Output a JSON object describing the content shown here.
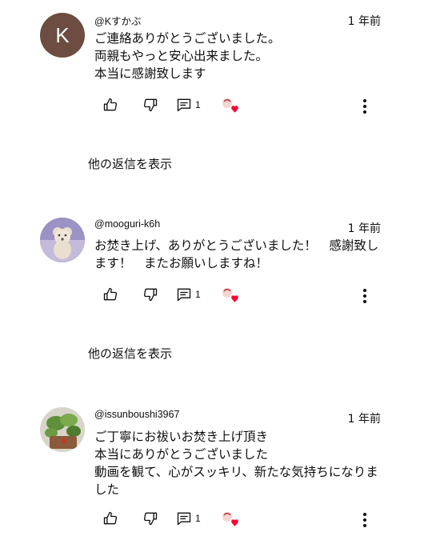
{
  "comments": [
    {
      "avatar_letter": "K",
      "avatar_color": "#6d4c41",
      "handle": "@Kすかぶ",
      "time": "1 年前",
      "text": "ご連絡ありがとうございました。\n両親もやっと安心出来ました。\n本当に感謝致します",
      "reply_count": "1",
      "show_replies": "他の返信を表示"
    },
    {
      "avatar_image": "teddy-bear-photo",
      "handle": "@mooguri-k6h",
      "time": "1 年前",
      "text": "お焚き上げ、ありがとうございました！　感謝致します！　またお願いしますね！",
      "reply_count": "1",
      "show_replies": "他の返信を表示"
    },
    {
      "avatar_image": "plant-photo",
      "handle": "@issunboushi3967",
      "time": "1 年前",
      "text": "ご丁寧にお祓いお焚き上げ頂き\n本当にありがとうございました\n動画を観て、心がスッキリ、新たな気持ちになりました",
      "reply_count": "1"
    }
  ],
  "icons": {
    "like": "thumbs-up-icon",
    "dislike": "thumbs-down-icon",
    "reply": "comment-icon",
    "creator_heart": "creator-heart-icon",
    "more": "more-vert-icon"
  },
  "colors": {
    "heart": "#ff0033",
    "avatar_k": "#6d4c41"
  }
}
